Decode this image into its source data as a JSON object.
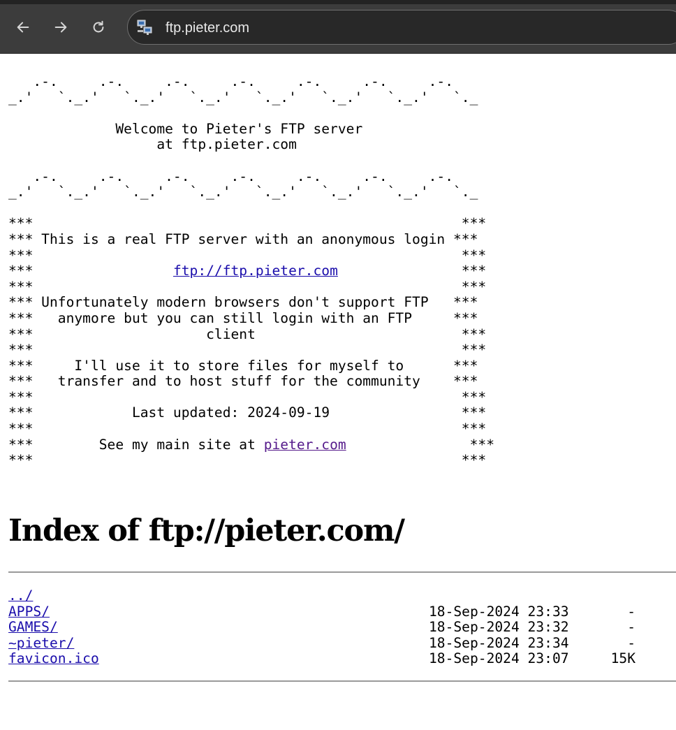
{
  "browser": {
    "url": "ftp.pieter.com",
    "back_icon": "arrow-left-icon",
    "forward_icon": "arrow-right-icon",
    "reload_icon": "reload-icon",
    "site_icon": "network-computer-icon",
    "colors": {
      "toolbar": "#3c3c3c",
      "omnibox": "#282828",
      "url_text": "#e8e8e8"
    }
  },
  "banner": {
    "wave_line_1": "   .-.     .-.     .-.     .-.     .-.     .-.     .-.",
    "wave_line_2": "_.'   `._.'   `._.'   `._.'   `._.'   `._.'   `._.'   `._",
    "welcome": "             Welcome to Pieter's FTP server",
    "at_host": "                  at ftp.pieter.com",
    "lines": [
      "***                                                    ***",
      "*** This is a real FTP server with an anonymous login ***",
      "***                                                    ***",
      "LINK_FTP",
      "***                                                    ***",
      "*** Unfortunately modern browsers don't support FTP   ***",
      "***   anymore but you can still login with an FTP     ***",
      "***                     client                         ***",
      "***                                                    ***",
      "***     I'll use it to store files for myself to      ***",
      "***   transfer and to host stuff for the community    ***",
      "***                                                    ***",
      "***            Last updated: 2024-09-19                ***",
      "***                                                    ***",
      "LINK_SITE",
      "***                                                    ***"
    ],
    "ftp_link_prefix": "***                 ",
    "ftp_link_text": "ftp://ftp.pieter.com",
    "ftp_link_suffix": "               ***",
    "site_link_prefix": "***        See my main site at ",
    "site_link_text": "pieter.com",
    "site_link_suffix": "               ***"
  },
  "index": {
    "title": "Index of ftp://pieter.com/",
    "entries": [
      {
        "name": "../",
        "date": "",
        "size": ""
      },
      {
        "name": "APPS/",
        "date": "18-Sep-2024 23:33",
        "size": "-"
      },
      {
        "name": "GAMES/",
        "date": "18-Sep-2024 23:32",
        "size": "-"
      },
      {
        "name": "~pieter/",
        "date": "18-Sep-2024 23:34",
        "size": "-"
      },
      {
        "name": "favicon.ico",
        "date": "18-Sep-2024 23:07",
        "size": "15K"
      }
    ]
  }
}
